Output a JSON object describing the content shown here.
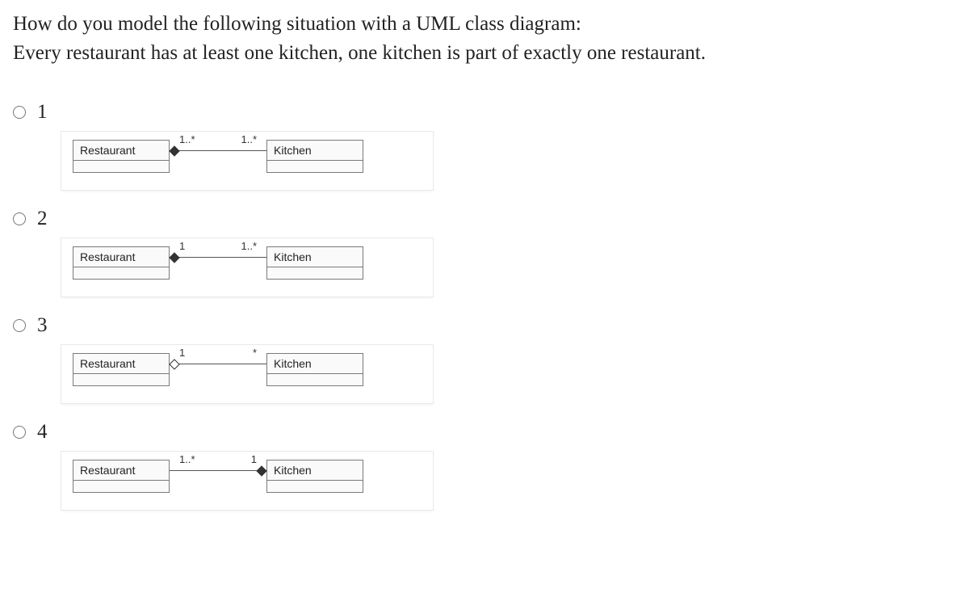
{
  "question": {
    "line1": "How do you model the following situation with a UML class diagram:",
    "line2": "Every restaurant has at least one kitchen, one kitchen is part of exactly one restaurant."
  },
  "options": [
    {
      "number": "1",
      "left_class": "Restaurant",
      "right_class": "Kitchen",
      "mult_left": "1..*",
      "mult_right": "1..*",
      "diamond_side": "left",
      "diamond_fill": "solid"
    },
    {
      "number": "2",
      "left_class": "Restaurant",
      "right_class": "Kitchen",
      "mult_left": "1",
      "mult_right": "1..*",
      "diamond_side": "left",
      "diamond_fill": "solid"
    },
    {
      "number": "3",
      "left_class": "Restaurant",
      "right_class": "Kitchen",
      "mult_left": "1",
      "mult_right": "*",
      "diamond_side": "left",
      "diamond_fill": "hollow"
    },
    {
      "number": "4",
      "left_class": "Restaurant",
      "right_class": "Kitchen",
      "mult_left": "1..*",
      "mult_right": "1",
      "diamond_side": "right",
      "diamond_fill": "solid"
    }
  ]
}
